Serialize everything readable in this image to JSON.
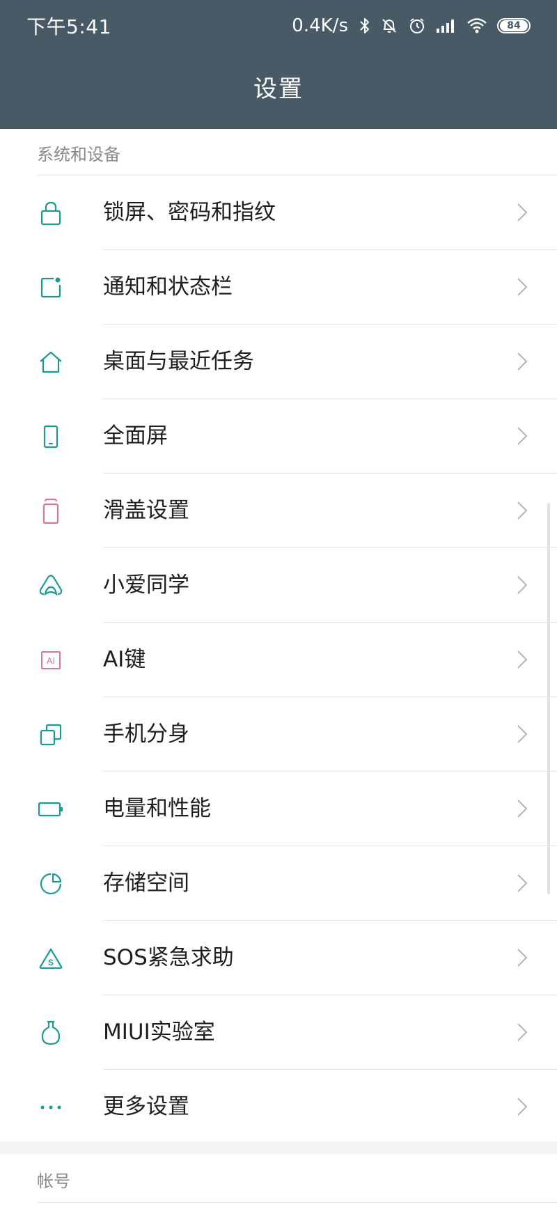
{
  "status_bar": {
    "time": "下午5:41",
    "net_speed": "0.4K/s",
    "battery": "84"
  },
  "header": {
    "title": "设置"
  },
  "sections": [
    {
      "label": "系统和设备",
      "items": [
        {
          "label": "锁屏、密码和指纹",
          "icon": "lock-icon"
        },
        {
          "label": "通知和状态栏",
          "icon": "notification-icon"
        },
        {
          "label": "桌面与最近任务",
          "icon": "home-icon"
        },
        {
          "label": "全面屏",
          "icon": "phone-screen-icon"
        },
        {
          "label": "滑盖设置",
          "icon": "slider-cover-icon"
        },
        {
          "label": "小爱同学",
          "icon": "xiaoai-icon"
        },
        {
          "label": "AI键",
          "icon": "ai-key-icon"
        },
        {
          "label": "手机分身",
          "icon": "second-space-icon"
        },
        {
          "label": "电量和性能",
          "icon": "battery-icon"
        },
        {
          "label": "存储空间",
          "icon": "storage-icon"
        },
        {
          "label": "SOS紧急求助",
          "icon": "sos-icon"
        },
        {
          "label": "MIUI实验室",
          "icon": "lab-flask-icon"
        },
        {
          "label": "更多设置",
          "icon": "more-dots-icon"
        }
      ]
    },
    {
      "label": "帐号"
    }
  ],
  "colors": {
    "header_bg": "#485a66",
    "icon_teal": "#1a9a93",
    "icon_pink": "#d47a8c",
    "chevron": "#b5b5b5"
  }
}
